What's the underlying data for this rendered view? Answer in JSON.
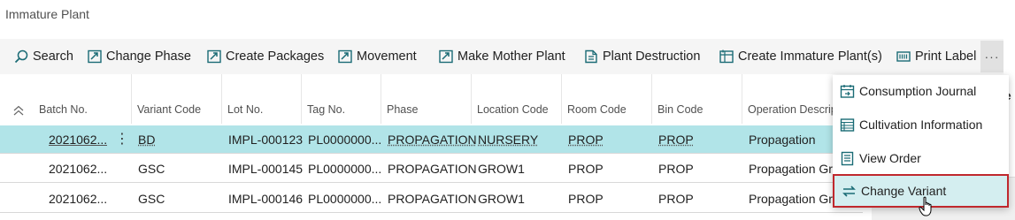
{
  "page": {
    "title": "Immature Plant"
  },
  "actions": [
    {
      "key": "search",
      "label": "Search",
      "icon": "search-icon"
    },
    {
      "key": "change-phase",
      "label": "Change Phase",
      "icon": "change-phase-icon"
    },
    {
      "key": "create-packages",
      "label": "Create Packages",
      "icon": "create-packages-icon"
    },
    {
      "key": "movement",
      "label": "Movement",
      "icon": "movement-icon"
    },
    {
      "key": "make-mother-plant",
      "label": "Make Mother Plant",
      "icon": "mother-plant-icon"
    },
    {
      "key": "plant-destruction",
      "label": "Plant Destruction",
      "icon": "plant-destruction-icon"
    },
    {
      "key": "create-immature-plants",
      "label": "Create Immature Plant(s)",
      "icon": "create-immature-plant-icon"
    },
    {
      "key": "print-label",
      "label": "Print Label",
      "icon": "print-label-icon"
    }
  ],
  "more_label": "···",
  "columns": [
    "Batch No.",
    "Variant Code",
    "Lot No.",
    "Tag No.",
    "Phase",
    "Location Code",
    "Room Code",
    "Bin Code",
    "Operation Descript"
  ],
  "rows": [
    {
      "batch": "2021062...",
      "variant": "BD",
      "lot": "IMPL-000123",
      "tag": "PL0000000...",
      "phase": "PROPAGATION",
      "location": "NURSERY",
      "room": "PROP",
      "bin": "PROP",
      "operation": "Propagation",
      "selected": true
    },
    {
      "batch": "2021062...",
      "variant": "GSC",
      "lot": "IMPL-000145",
      "tag": "PL0000000...",
      "phase": "PROPAGATION",
      "location": "GROW1",
      "room": "PROP",
      "bin": "PROP",
      "operation": "Propagation Gro",
      "selected": false
    },
    {
      "batch": "2021062...",
      "variant": "GSC",
      "lot": "IMPL-000146",
      "tag": "PL0000000...",
      "phase": "PROPAGATION",
      "location": "GROW1",
      "room": "PROP",
      "bin": "PROP",
      "operation": "Propagation Gro",
      "selected": false
    }
  ],
  "menu": [
    {
      "label": "Consumption Journal",
      "icon": "consumption-journal-icon"
    },
    {
      "label": "Cultivation Information",
      "icon": "cultivation-information-icon"
    },
    {
      "label": "View Order",
      "icon": "view-order-icon"
    },
    {
      "label": "Change Variant",
      "icon": "change-variant-icon",
      "hovered": true
    }
  ],
  "side": {
    "fragment": "le"
  },
  "colors": {
    "accent": "#1a6b75",
    "selected_row": "#b1e4e8",
    "highlight_border": "#c0282d"
  }
}
